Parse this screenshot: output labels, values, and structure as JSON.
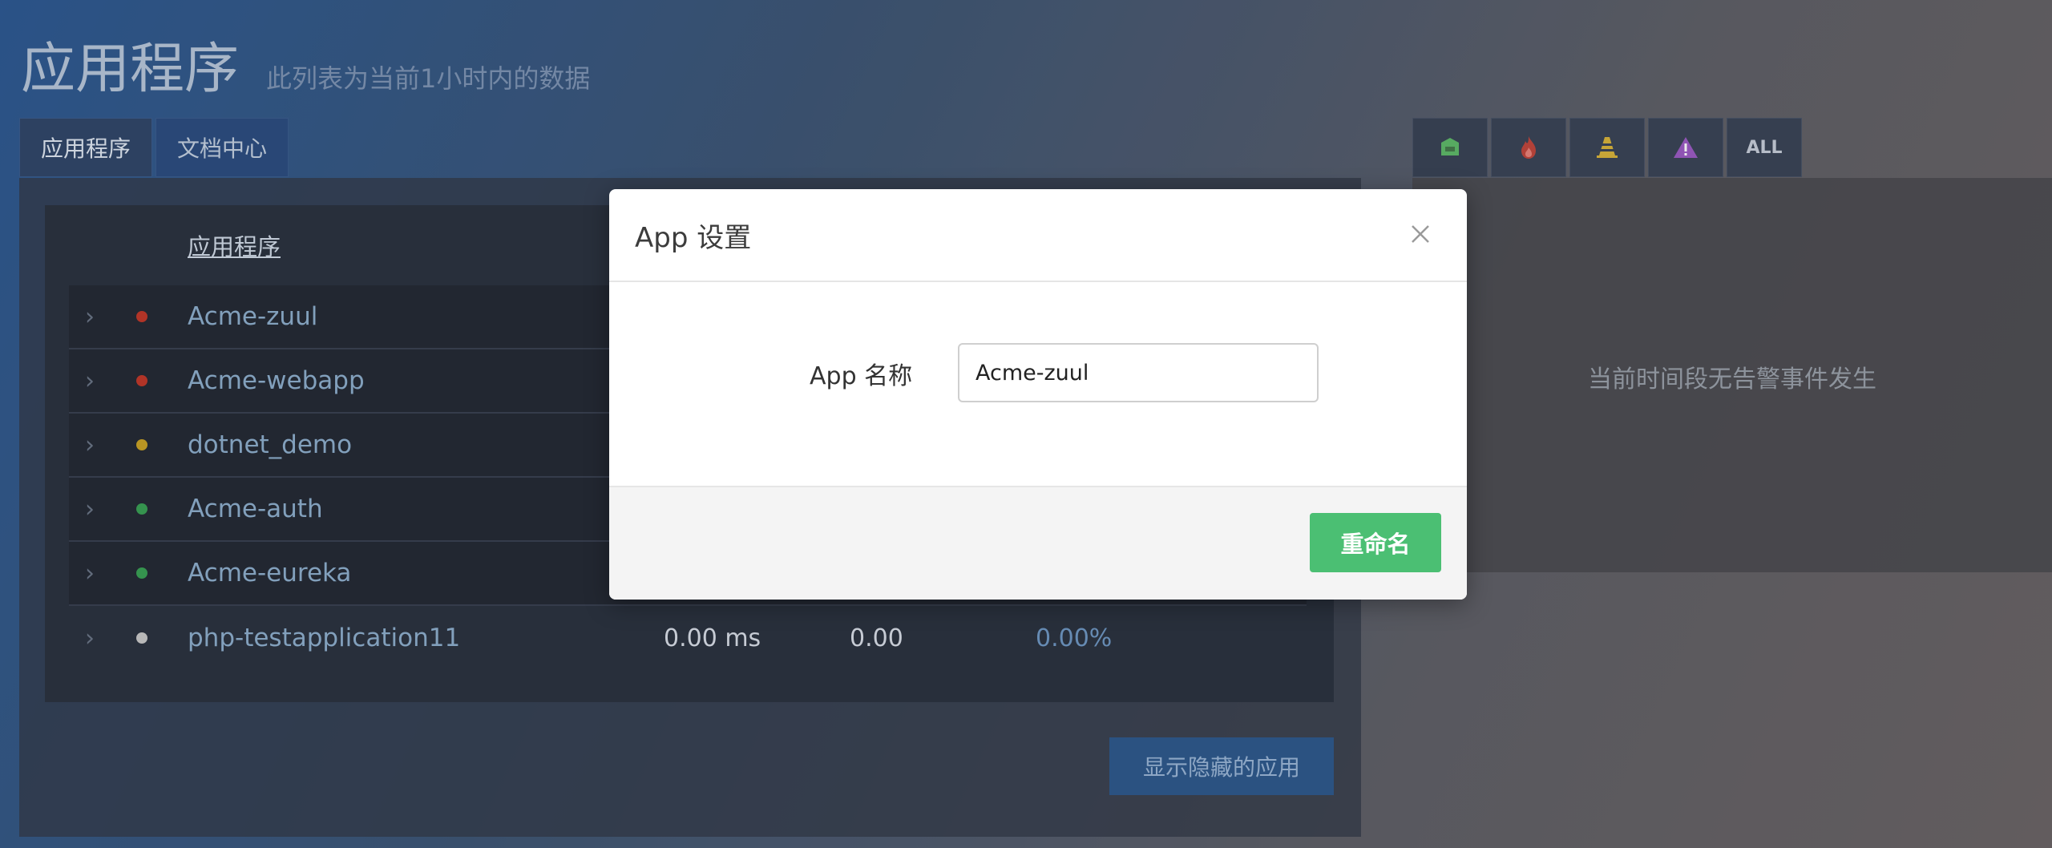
{
  "page": {
    "title": "应用程序",
    "subtitle": "此列表为当前1小时内的数据"
  },
  "left_tabs": [
    {
      "label": "应用程序",
      "active": true
    },
    {
      "label": "文档中心",
      "active": false
    }
  ],
  "table": {
    "column_name": "应用程序",
    "rows": [
      {
        "name": "Acme-zuul",
        "status": "red",
        "response_time": "",
        "apdex": "",
        "error_rate": ""
      },
      {
        "name": "Acme-webapp",
        "status": "red",
        "response_time": "",
        "apdex": "",
        "error_rate": ""
      },
      {
        "name": "dotnet_demo",
        "status": "yellow",
        "response_time": "",
        "apdex": "",
        "error_rate": ""
      },
      {
        "name": "Acme-auth",
        "status": "green",
        "response_time": "",
        "apdex": "",
        "error_rate": ""
      },
      {
        "name": "Acme-eureka",
        "status": "green",
        "response_time": "",
        "apdex": "",
        "error_rate": ""
      },
      {
        "name": "php-testapplication11",
        "status": "gray",
        "response_time": "0.00 ms",
        "apdex": "0.00",
        "error_rate": "0.00%"
      }
    ]
  },
  "show_hidden_label": "显示隐藏的应用",
  "filter_tabs": [
    {
      "icon": "inbox-icon",
      "color": "#5fb96a"
    },
    {
      "icon": "fire-icon",
      "color": "#c0473d"
    },
    {
      "icon": "traffic-cone-icon",
      "color": "#d8b43c"
    },
    {
      "icon": "warning-icon",
      "color": "#9c5cc4"
    },
    {
      "label": "ALL"
    }
  ],
  "right_panel": {
    "empty_text": "当前时间段无告警事件发生"
  },
  "modal": {
    "title": "App 设置",
    "field_label": "App 名称",
    "field_value": "Acme-zuul",
    "rename_label": "重命名"
  },
  "colors": {
    "status_red": "#c0392b",
    "status_yellow": "#c9a227",
    "status_green": "#3aa055",
    "status_gray": "#c8c8c8",
    "primary_green": "#4bbf73"
  }
}
